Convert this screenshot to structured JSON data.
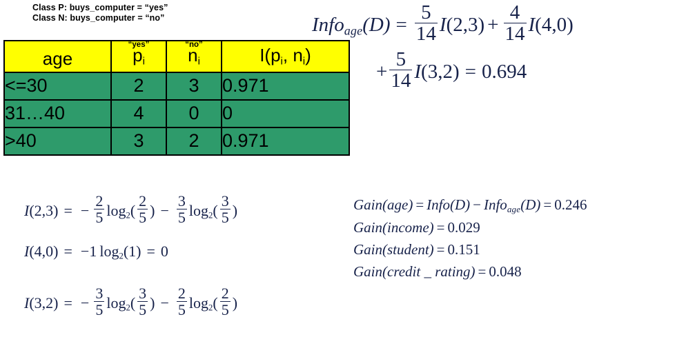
{
  "class_legend": {
    "line_p": "Class P: buys_computer = “yes”",
    "line_n": "Class N: buys_computer = “no”"
  },
  "colors": {
    "header_background": "#FFFF00",
    "row_background": "#2E9B6B",
    "border": "#000000",
    "math_text": "#17224A",
    "text": "#000000"
  },
  "table": {
    "headers": [
      {
        "quote": "",
        "main": "age",
        "sub": ""
      },
      {
        "quote": "“yes”",
        "main": "p",
        "sub": "i"
      },
      {
        "quote": "“no”",
        "main": "n",
        "sub": "i"
      },
      {
        "quote": "",
        "main": "I(p",
        "sub": "i",
        "main2": ", n",
        "sub2": "i",
        "main3": ")"
      }
    ],
    "header_labels": [
      "age",
      "“yes” pᵢ",
      "“no” nᵢ",
      "I(pᵢ, nᵢ)"
    ],
    "rows": [
      {
        "age": "<=30",
        "p": "2",
        "n": "3",
        "i": "0.971"
      },
      {
        "age": "31…40",
        "p": "4",
        "n": "0",
        "i": "0"
      },
      {
        "age": ">40",
        "p": "3",
        "n": "2",
        "i": "0.971"
      }
    ]
  },
  "info_equation": {
    "line1": {
      "lhs_name": "Info",
      "lhs_sub": "age",
      "lhs_arg": "(D)",
      "equals": "=",
      "term1_num": "5",
      "term1_den": "14",
      "term1_fn": "I",
      "term1_args": "(2,3)",
      "plus": "+",
      "term2_num": "4",
      "term2_den": "14",
      "term2_fn": "I",
      "term2_args": "(4,0)"
    },
    "line2": {
      "plus": "+",
      "term3_num": "5",
      "term3_den": "14",
      "term3_fn": "I",
      "term3_args": "(3,2)",
      "equals": "=",
      "result": "0.694"
    }
  },
  "entropy_equations": [
    {
      "lhs_fn": "I",
      "lhs_args": "(2,3)",
      "equals": "=",
      "sign1": "−",
      "f1_num": "2",
      "f1_den": "5",
      "log1": "log",
      "log1_base": "2",
      "arg1_open": "(",
      "arg1_num": "2",
      "arg1_den": "5",
      "arg1_close": ")",
      "sign2": "−",
      "f2_num": "3",
      "f2_den": "5",
      "log2": "log",
      "log2_base": "2",
      "arg2_open": "(",
      "arg2_num": "3",
      "arg2_den": "5",
      "arg2_close": ")"
    },
    {
      "lhs_fn": "I",
      "lhs_args": "(4,0)",
      "equals": "=",
      "sign1": "−1",
      "log1": "log",
      "log1_base": "2",
      "arg1": "(1)",
      "equals2": "=",
      "result": "0"
    },
    {
      "lhs_fn": "I",
      "lhs_args": "(3,2)",
      "equals": "=",
      "sign1": "−",
      "f1_num": "3",
      "f1_den": "5",
      "log1": "log",
      "log1_base": "2",
      "arg1_open": "(",
      "arg1_num": "3",
      "arg1_den": "5",
      "arg1_close": ")",
      "sign2": "−",
      "f2_num": "2",
      "f2_den": "5",
      "log2": "log",
      "log2_base": "2",
      "arg2_open": "(",
      "arg2_num": "2",
      "arg2_den": "5",
      "arg2_close": ")"
    }
  ],
  "gain_equations": {
    "age": {
      "fn": "Gain",
      "arg": "(age)",
      "equals": "=",
      "rhs_fn1": "Info",
      "rhs_arg1": "(D)",
      "minus": "−",
      "rhs_fn2": "Info",
      "rhs_sub2": "age",
      "rhs_arg2": "(D)",
      "equals2": "=",
      "value": "0.246"
    },
    "income": {
      "fn": "Gain",
      "arg": "(income)",
      "equals": "=",
      "value": "0.029"
    },
    "student": {
      "fn": "Gain",
      "arg": "(student)",
      "equals": "=",
      "value": "0.151"
    },
    "credit_rating": {
      "fn": "Gain",
      "arg": "(credit _ rating)",
      "equals": "=",
      "value": "0.048"
    }
  }
}
